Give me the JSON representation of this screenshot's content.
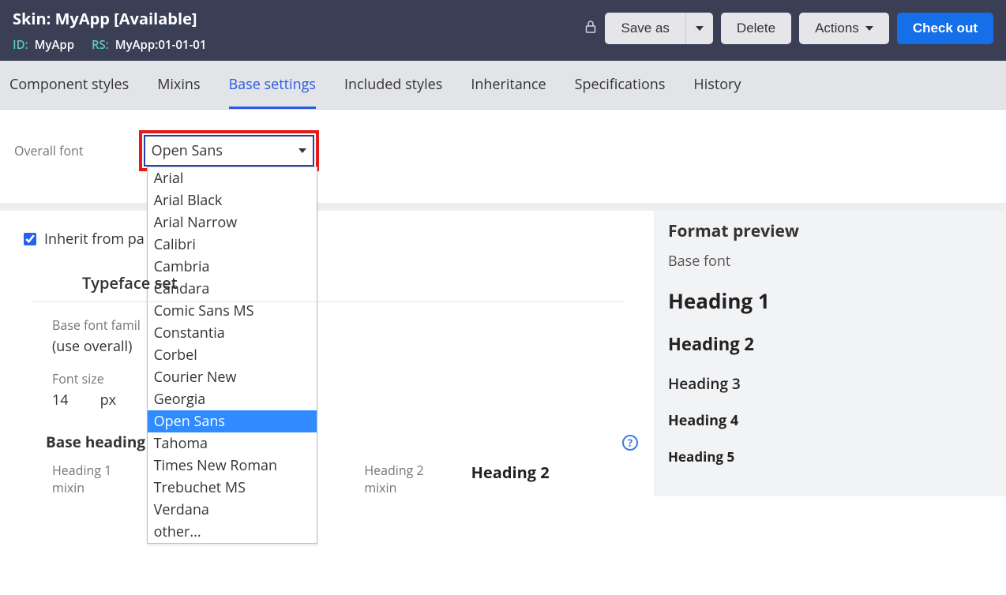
{
  "header": {
    "title_prefix": "Skin:",
    "title_name": "MyApp",
    "title_status": "[Available]",
    "id_label": "ID:",
    "id_value": "MyApp",
    "rs_label": "RS:",
    "rs_value": "MyApp:01-01-01",
    "save_as": "Save as",
    "delete": "Delete",
    "actions": "Actions",
    "checkout": "Check out"
  },
  "tabs": {
    "component_styles": "Component styles",
    "mixins": "Mixins",
    "base_settings": "Base settings",
    "included_styles": "Included styles",
    "inheritance": "Inheritance",
    "specifications": "Specifications",
    "history": "History"
  },
  "overall": {
    "label": "Overall font",
    "selected": "Open Sans",
    "options": {
      "arial": "Arial",
      "arial_black": "Arial Black",
      "arial_narrow": "Arial Narrow",
      "calibri": "Calibri",
      "cambria": "Cambria",
      "candara": "Candara",
      "comic": "Comic Sans MS",
      "constantia": "Constantia",
      "corbel": "Corbel",
      "courier": "Courier New",
      "georgia": "Georgia",
      "open_sans": "Open Sans",
      "tahoma": "Tahoma",
      "times": "Times New Roman",
      "trebuchet": "Trebuchet MS",
      "verdana": "Verdana",
      "other": "other..."
    }
  },
  "inherit": {
    "label": "Inherit from pa"
  },
  "typeface": {
    "title": "Typeface set",
    "base_font_label": "Base font famil",
    "base_font_value": "(use overall)",
    "font_size_label": "Font size",
    "font_size_value": "14",
    "font_size_unit": "px"
  },
  "base_heading": {
    "title": "Base heading",
    "heading1_label_a": "Heading 1",
    "heading1_label_b": "mixin",
    "heading2_label_a": "Heading 2",
    "heading2_label_b": "mixin",
    "heading2_preview": "Heading 2"
  },
  "preview": {
    "title": "Format preview",
    "basefont": "Base font",
    "h1": "Heading 1",
    "h2": "Heading 2",
    "h3": "Heading 3",
    "h4": "Heading 4",
    "h5": "Heading 5"
  }
}
